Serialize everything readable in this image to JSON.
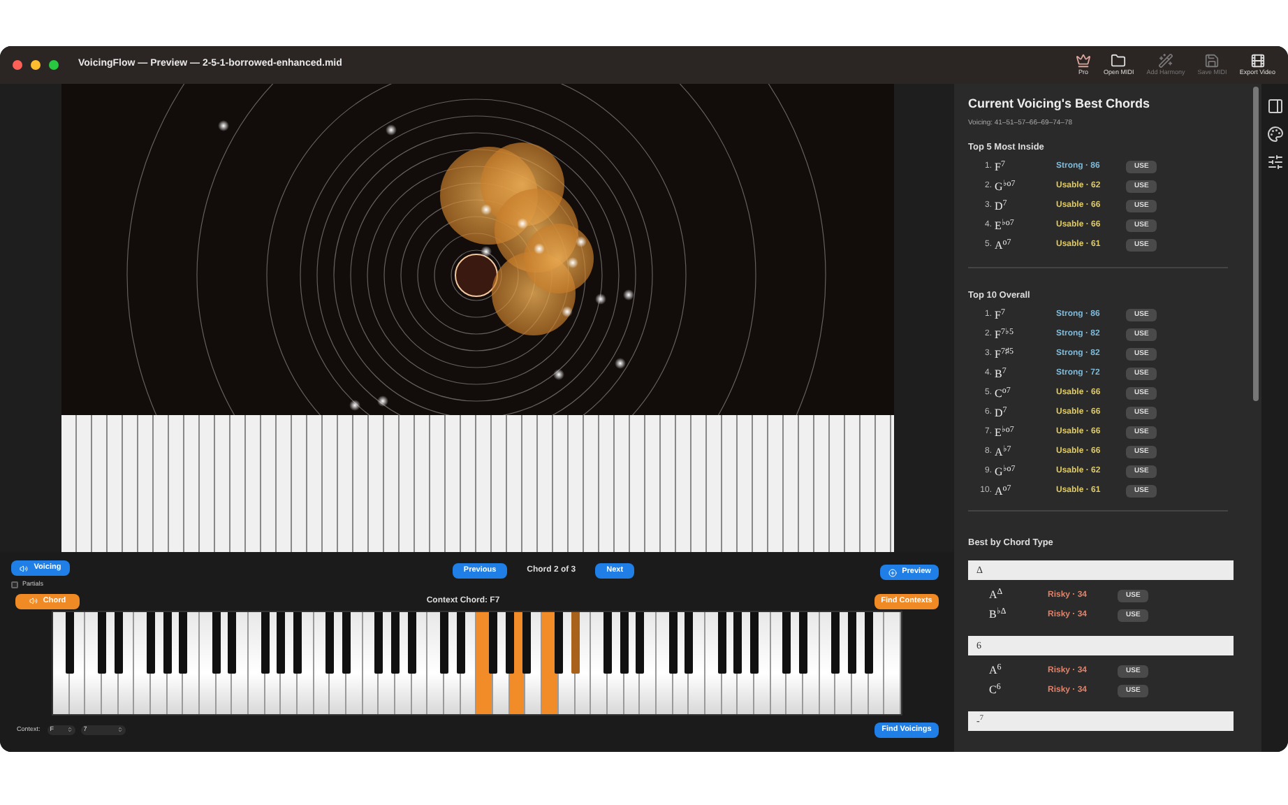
{
  "window": {
    "title": "VoicingFlow — Preview — 2-5-1-borrowed-enhanced.mid"
  },
  "toolbar": [
    {
      "label": "Pro",
      "disabled": false
    },
    {
      "label": "Open MIDI",
      "disabled": false
    },
    {
      "label": "Add Harmony",
      "disabled": true
    },
    {
      "label": "Save MIDI",
      "disabled": true
    },
    {
      "label": "Export Video",
      "disabled": false
    }
  ],
  "controls": {
    "voicing_button": "Voicing",
    "partials": {
      "label": "Partials",
      "checked": false
    },
    "previous": "Previous",
    "position": "Chord 2 of 3",
    "next": "Next",
    "preview": "Preview",
    "chord_button": "Chord",
    "context_chord": "Context Chord: F7",
    "find_contexts": "Find Contexts",
    "context_label": "Context:",
    "context_root": "F",
    "context_quality": "7",
    "find_voicings": "Find Voicings"
  },
  "keyboard": {
    "keys": [
      false,
      false,
      false,
      false,
      false,
      false,
      false,
      false,
      false,
      false,
      false,
      false,
      false,
      false,
      false,
      false,
      false,
      false,
      false,
      false,
      false,
      false,
      false,
      false,
      false,
      false,
      false,
      false,
      false,
      false,
      false,
      false,
      false,
      false,
      false,
      false,
      false,
      false,
      false,
      false,
      false,
      false,
      false,
      false,
      true,
      false,
      false,
      false,
      true,
      false,
      false,
      true,
      false,
      false,
      true,
      false,
      false,
      false,
      false,
      false,
      false,
      false,
      false,
      false,
      false,
      false,
      false,
      false,
      false,
      false,
      false,
      false,
      false,
      false,
      false,
      false,
      false,
      false,
      false,
      false,
      false,
      false,
      false,
      false,
      false,
      false,
      false,
      false
    ]
  },
  "panel": {
    "title": "Current Voicing's Best Chords",
    "voicing": "Voicing: 41–51–57–66–69–74–78",
    "top5": {
      "heading": "Top 5 Most Inside",
      "rows": [
        {
          "rank": "1.",
          "chord": "F$^{7}$",
          "score": "Strong · 86",
          "kind": "strong",
          "action": "USE"
        },
        {
          "rank": "2.",
          "chord": "G$^{♭o7}$",
          "score": "Usable · 62",
          "kind": "usable",
          "action": "USE"
        },
        {
          "rank": "3.",
          "chord": "D$^{7}$",
          "score": "Usable · 66",
          "kind": "usable",
          "action": "USE"
        },
        {
          "rank": "4.",
          "chord": "E$^{♭o7}$",
          "score": "Usable · 66",
          "kind": "usable",
          "action": "USE"
        },
        {
          "rank": "5.",
          "chord": "A$^{o7}$",
          "score": "Usable · 61",
          "kind": "usable",
          "action": "USE"
        }
      ]
    },
    "top10": {
      "heading": "Top 10 Overall",
      "rows": [
        {
          "rank": "1.",
          "chord": "F$^{7}$",
          "score": "Strong · 86",
          "kind": "strong",
          "action": "USE"
        },
        {
          "rank": "2.",
          "chord": "F$^{7♭5}$",
          "score": "Strong · 82",
          "kind": "strong",
          "action": "USE"
        },
        {
          "rank": "3.",
          "chord": "F$^{7♯5}$",
          "score": "Strong · 82",
          "kind": "strong",
          "action": "USE"
        },
        {
          "rank": "4.",
          "chord": "B$^{7}$",
          "score": "Strong · 72",
          "kind": "strong",
          "action": "USE"
        },
        {
          "rank": "5.",
          "chord": "C$^{o7}$",
          "score": "Usable · 66",
          "kind": "usable",
          "action": "USE"
        },
        {
          "rank": "6.",
          "chord": "D$^{7}$",
          "score": "Usable · 66",
          "kind": "usable",
          "action": "USE"
        },
        {
          "rank": "7.",
          "chord": "E$^{♭o7}$",
          "score": "Usable · 66",
          "kind": "usable",
          "action": "USE"
        },
        {
          "rank": "8.",
          "chord": "A$^{♭7}$",
          "score": "Usable · 66",
          "kind": "usable",
          "action": "USE"
        },
        {
          "rank": "9.",
          "chord": "G$^{♭o7}$",
          "score": "Usable · 62",
          "kind": "usable",
          "action": "USE"
        },
        {
          "rank": "10.",
          "chord": "A$^{o7}$",
          "score": "Usable · 61",
          "kind": "usable",
          "action": "USE"
        }
      ]
    },
    "by_type": {
      "heading": "Best by Chord Type",
      "groups": [
        {
          "type": "Δ",
          "rows": [
            {
              "chord": "A$^{Δ}$",
              "score": "Risky · 34",
              "kind": "risky",
              "action": "USE"
            },
            {
              "chord": "B$^{♭Δ}$",
              "score": "Risky · 34",
              "kind": "risky",
              "action": "USE"
            }
          ]
        },
        {
          "type": "6",
          "rows": [
            {
              "chord": "A$^{6}$",
              "score": "Risky · 34",
              "kind": "risky",
              "action": "USE"
            },
            {
              "chord": "C$^{6}$",
              "score": "Risky · 34",
              "kind": "risky",
              "action": "USE"
            }
          ]
        },
        {
          "type": "-$^{7}$"
        }
      ]
    }
  }
}
